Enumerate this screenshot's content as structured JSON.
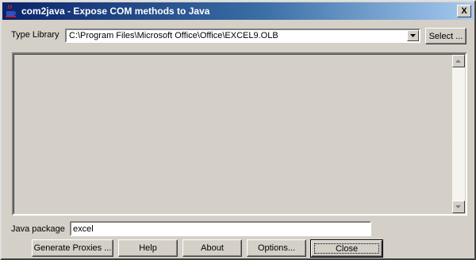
{
  "window": {
    "title": "com2java - Expose COM methods to Java",
    "close_label": "X"
  },
  "type_library": {
    "label": "Type Library",
    "value": "C:\\Program Files\\Microsoft Office\\Office\\EXCEL9.OLB",
    "select_label": "Select ..."
  },
  "java_package": {
    "label": "Java package",
    "value": "excel"
  },
  "buttons": {
    "generate": "Generate Proxies ...",
    "help": "Help",
    "about": "About",
    "options": "Options...",
    "close": "Close"
  },
  "icons": {
    "app": "java-cup-icon",
    "combo_arrow": "chevron-down-icon",
    "scroll_up": "scroll-up-arrow-icon",
    "scroll_down": "scroll-down-arrow-icon"
  }
}
